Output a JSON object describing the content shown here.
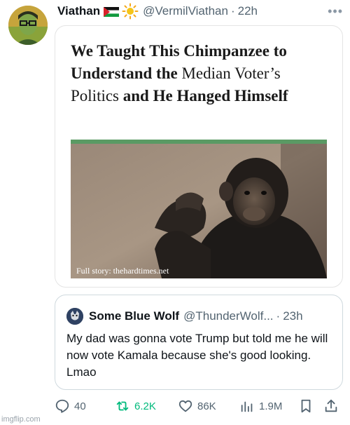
{
  "tweet": {
    "display_name": "Viathan",
    "handle": "@VermilViathan",
    "separator": "·",
    "time": "22h"
  },
  "article": {
    "headline_part1": "We Taught This Chimpanzee to Understand the",
    "headline_part2": "Median Voter’s Politics",
    "headline_part3": "and He Hanged Himself",
    "caption": "Full story: thehardtimes.net"
  },
  "quoted_tweet": {
    "display_name": "Some Blue Wolf",
    "handle": "@ThunderWolf...",
    "separator": "·",
    "time": "23h",
    "text": "My dad was gonna vote Trump but told me he will now vote Kamala because she's good looking. Lmao"
  },
  "actions": {
    "replies": "40",
    "reposts": "6.2K",
    "likes": "86K",
    "views": "1.9M"
  },
  "watermark": "imgflip.com",
  "colors": {
    "accent_green": "#00ba7c",
    "muted_text": "#536471",
    "article_bar": "#5a9a64"
  }
}
